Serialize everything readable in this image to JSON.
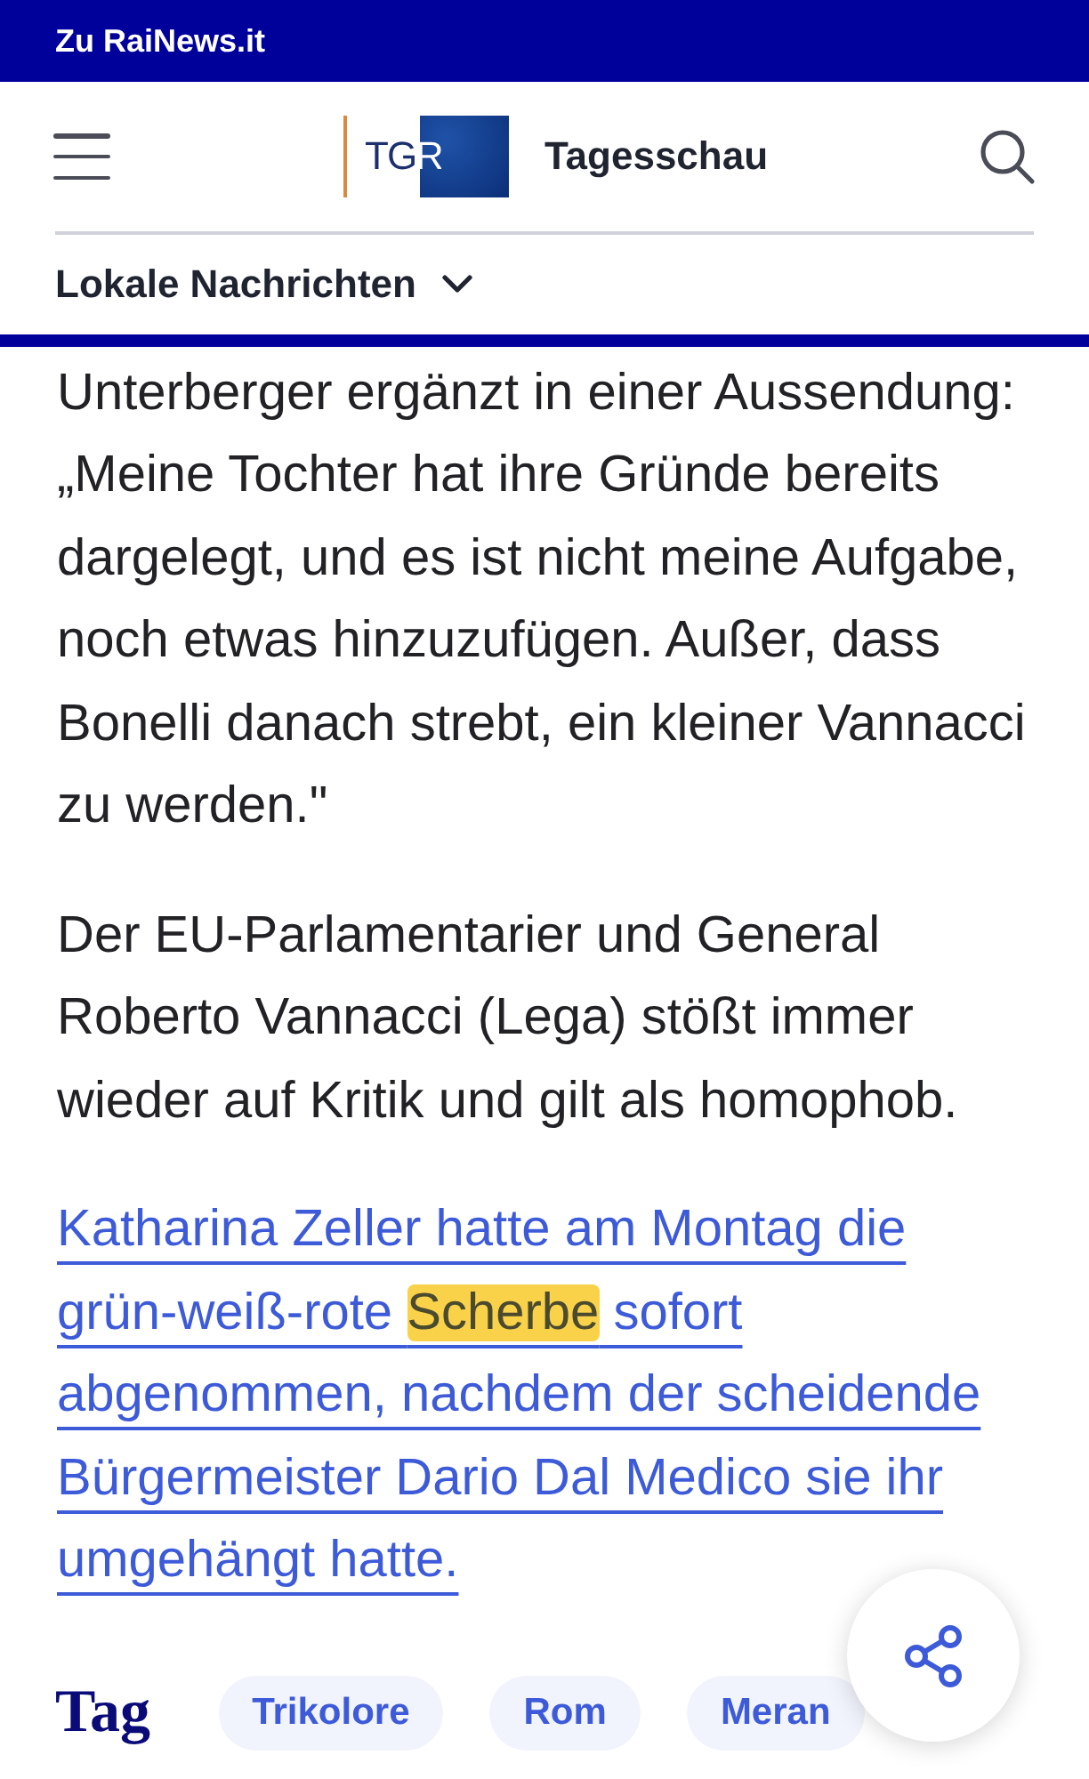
{
  "top_bar": {
    "link": "Zu RaiNews.it"
  },
  "header": {
    "logo_text": "TGR",
    "title": "Tagesschau"
  },
  "section_menu": {
    "label": "Lokale Nachrichten",
    "expanded": false
  },
  "article": {
    "paragraphs": [
      {
        "kind": "text",
        "text": "Unterberger ergänzt in einer Aussendung: „Meine Tochter hat ihre Gründe bereits dargelegt, und es ist nicht meine Aufgabe, noch etwas hinzuzufügen. Außer, dass Bonelli danach strebt, ein kleiner Vannacci zu werden.\""
      },
      {
        "kind": "text",
        "text": "Der EU-Parlamentarier und General Roberto Vannacci (Lega) stößt immer wieder auf Kritik und gilt als homophob."
      },
      {
        "kind": "link",
        "parts": [
          {
            "text": "Katharina Zeller hatte am Montag die grün-weiß-rote ",
            "highlighted": false
          },
          {
            "text": "Scherbe",
            "highlighted": true
          },
          {
            "text": " sofort abgenommen, nachdem der scheidende Bürgermeister Dario Dal Medico sie ihr umgehängt hatte.",
            "highlighted": false
          }
        ]
      }
    ]
  },
  "tags": {
    "label": "Tag",
    "items": [
      "Trikolore",
      "Rom",
      "Meran"
    ]
  }
}
